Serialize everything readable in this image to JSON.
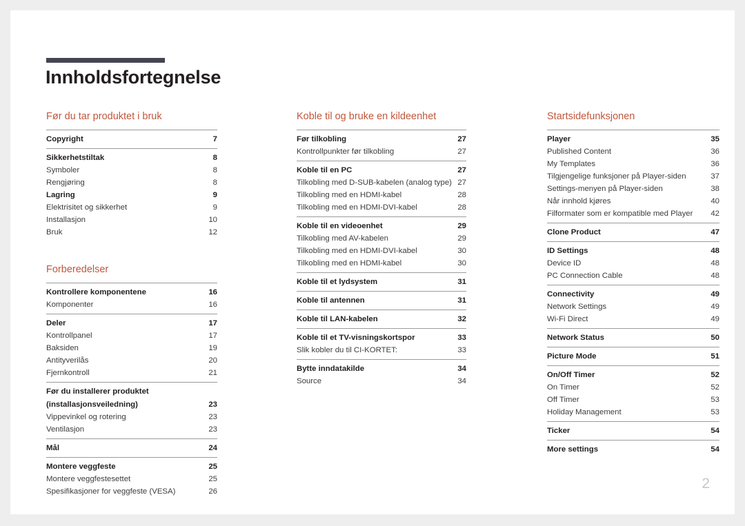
{
  "document": {
    "title": "Innholdsfortegnelse",
    "page_number": "2",
    "accent_color": "#c0573c",
    "rule_color": "#434552"
  },
  "columns": [
    {
      "name": "column-1",
      "sections": [
        {
          "heading": "Før du tar produktet i bruk",
          "groups": [
            {
              "entries": [
                {
                  "label": "Copyright",
                  "page": "7",
                  "type": "chapter"
                }
              ]
            },
            {
              "entries": [
                {
                  "label": "Sikkerhetstiltak",
                  "page": "8",
                  "type": "chapter"
                },
                {
                  "label": "Symboler",
                  "page": "8",
                  "type": "sub"
                },
                {
                  "label": "Rengjøring",
                  "page": "8",
                  "type": "sub"
                },
                {
                  "label": "Lagring",
                  "page": "9",
                  "type": "chapter"
                },
                {
                  "label": "Elektrisitet og sikkerhet",
                  "page": "9",
                  "type": "sub"
                },
                {
                  "label": "Installasjon",
                  "page": "10",
                  "type": "sub"
                },
                {
                  "label": "Bruk",
                  "page": "12",
                  "type": "sub"
                }
              ]
            }
          ]
        },
        {
          "heading": "Forberedelser",
          "groups": [
            {
              "entries": [
                {
                  "label": "Kontrollere komponentene",
                  "page": "16",
                  "type": "chapter"
                },
                {
                  "label": "Komponenter",
                  "page": "16",
                  "type": "sub"
                }
              ]
            },
            {
              "entries": [
                {
                  "label": "Deler",
                  "page": "17",
                  "type": "chapter"
                },
                {
                  "label": "Kontrollpanel",
                  "page": "17",
                  "type": "sub"
                },
                {
                  "label": "Baksiden",
                  "page": "19",
                  "type": "sub"
                },
                {
                  "label": "Antityverilås",
                  "page": "20",
                  "type": "sub"
                },
                {
                  "label": "Fjernkontroll",
                  "page": "21",
                  "type": "sub"
                }
              ]
            },
            {
              "entries": [
                {
                  "label": "Før du installerer produktet",
                  "label2": "(installasjonsveiledning)",
                  "page": "23",
                  "type": "chapter-wrap"
                },
                {
                  "label": "Vippevinkel og rotering",
                  "page": "23",
                  "type": "sub"
                },
                {
                  "label": "Ventilasjon",
                  "page": "23",
                  "type": "sub"
                }
              ]
            },
            {
              "entries": [
                {
                  "label": "Mål",
                  "page": "24",
                  "type": "chapter"
                }
              ]
            },
            {
              "entries": [
                {
                  "label": "Montere veggfeste",
                  "page": "25",
                  "type": "chapter"
                },
                {
                  "label": "Montere veggfestesettet",
                  "page": "25",
                  "type": "sub"
                },
                {
                  "label": "Spesifikasjoner for veggfeste (VESA)",
                  "page": "26",
                  "type": "sub"
                }
              ]
            }
          ]
        }
      ]
    },
    {
      "name": "column-2",
      "sections": [
        {
          "heading": "Koble til og bruke en kildeenhet",
          "groups": [
            {
              "entries": [
                {
                  "label": "Før tilkobling",
                  "page": "27",
                  "type": "chapter"
                },
                {
                  "label": "Kontrollpunkter før tilkobling",
                  "page": "27",
                  "type": "sub"
                }
              ]
            },
            {
              "entries": [
                {
                  "label": "Koble til en PC",
                  "page": "27",
                  "type": "chapter"
                },
                {
                  "label": "Tilkobling med D-SUB-kabelen (analog type)",
                  "page": "27",
                  "type": "sub"
                },
                {
                  "label": "Tilkobling med en HDMI-kabel",
                  "page": "28",
                  "type": "sub"
                },
                {
                  "label": "Tilkobling med en HDMI-DVI-kabel",
                  "page": "28",
                  "type": "sub"
                }
              ]
            },
            {
              "entries": [
                {
                  "label": "Koble til en videoenhet",
                  "page": "29",
                  "type": "chapter"
                },
                {
                  "label": "Tilkobling med AV-kabelen",
                  "page": "29",
                  "type": "sub"
                },
                {
                  "label": "Tilkobling med en HDMI-DVI-kabel",
                  "page": "30",
                  "type": "sub"
                },
                {
                  "label": "Tilkobling med en HDMI-kabel",
                  "page": "30",
                  "type": "sub"
                }
              ]
            },
            {
              "entries": [
                {
                  "label": "Koble til et lydsystem",
                  "page": "31",
                  "type": "chapter"
                }
              ]
            },
            {
              "entries": [
                {
                  "label": "Koble til antennen",
                  "page": "31",
                  "type": "chapter"
                }
              ]
            },
            {
              "entries": [
                {
                  "label": "Koble til LAN-kabelen",
                  "page": "32",
                  "type": "chapter"
                }
              ]
            },
            {
              "entries": [
                {
                  "label": "Koble til et TV-visningskortspor",
                  "page": "33",
                  "type": "chapter"
                },
                {
                  "label": "Slik kobler du til CI-KORTET:",
                  "page": "33",
                  "type": "sub"
                }
              ]
            },
            {
              "entries": [
                {
                  "label": "Bytte inndatakilde",
                  "page": "34",
                  "type": "chapter"
                },
                {
                  "label": "Source",
                  "page": "34",
                  "type": "sub"
                }
              ]
            }
          ]
        }
      ]
    },
    {
      "name": "column-3",
      "sections": [
        {
          "heading": "Startsidefunksjonen",
          "groups": [
            {
              "entries": [
                {
                  "label": "Player",
                  "page": "35",
                  "type": "chapter"
                },
                {
                  "label": "Published Content",
                  "page": "36",
                  "type": "sub"
                },
                {
                  "label": "My Templates",
                  "page": "36",
                  "type": "sub"
                },
                {
                  "label": "Tilgjengelige funksjoner på Player-siden",
                  "page": "37",
                  "type": "sub"
                },
                {
                  "label": "Settings-menyen på Player-siden",
                  "page": "38",
                  "type": "sub"
                },
                {
                  "label": "Når innhold kjøres",
                  "page": "40",
                  "type": "sub"
                },
                {
                  "label": "Filformater som er kompatible med Player",
                  "page": "42",
                  "type": "sub"
                }
              ]
            },
            {
              "entries": [
                {
                  "label": "Clone Product",
                  "page": "47",
                  "type": "chapter"
                }
              ]
            },
            {
              "entries": [
                {
                  "label": "ID Settings",
                  "page": "48",
                  "type": "chapter"
                },
                {
                  "label": "Device ID",
                  "page": "48",
                  "type": "sub"
                },
                {
                  "label": "PC Connection Cable",
                  "page": "48",
                  "type": "sub"
                }
              ]
            },
            {
              "entries": [
                {
                  "label": "Connectivity",
                  "page": "49",
                  "type": "chapter"
                },
                {
                  "label": "Network Settings",
                  "page": "49",
                  "type": "sub"
                },
                {
                  "label": "Wi-Fi Direct",
                  "page": "49",
                  "type": "sub"
                }
              ]
            },
            {
              "entries": [
                {
                  "label": "Network Status",
                  "page": "50",
                  "type": "chapter"
                }
              ]
            },
            {
              "entries": [
                {
                  "label": "Picture Mode",
                  "page": "51",
                  "type": "chapter"
                }
              ]
            },
            {
              "entries": [
                {
                  "label": "On/Off Timer",
                  "page": "52",
                  "type": "chapter"
                },
                {
                  "label": "On Timer",
                  "page": "52",
                  "type": "sub"
                },
                {
                  "label": "Off Timer",
                  "page": "53",
                  "type": "sub"
                },
                {
                  "label": "Holiday Management",
                  "page": "53",
                  "type": "sub"
                }
              ]
            },
            {
              "entries": [
                {
                  "label": "Ticker",
                  "page": "54",
                  "type": "chapter"
                }
              ]
            },
            {
              "entries": [
                {
                  "label": "More settings",
                  "page": "54",
                  "type": "chapter"
                }
              ]
            }
          ]
        }
      ]
    }
  ]
}
